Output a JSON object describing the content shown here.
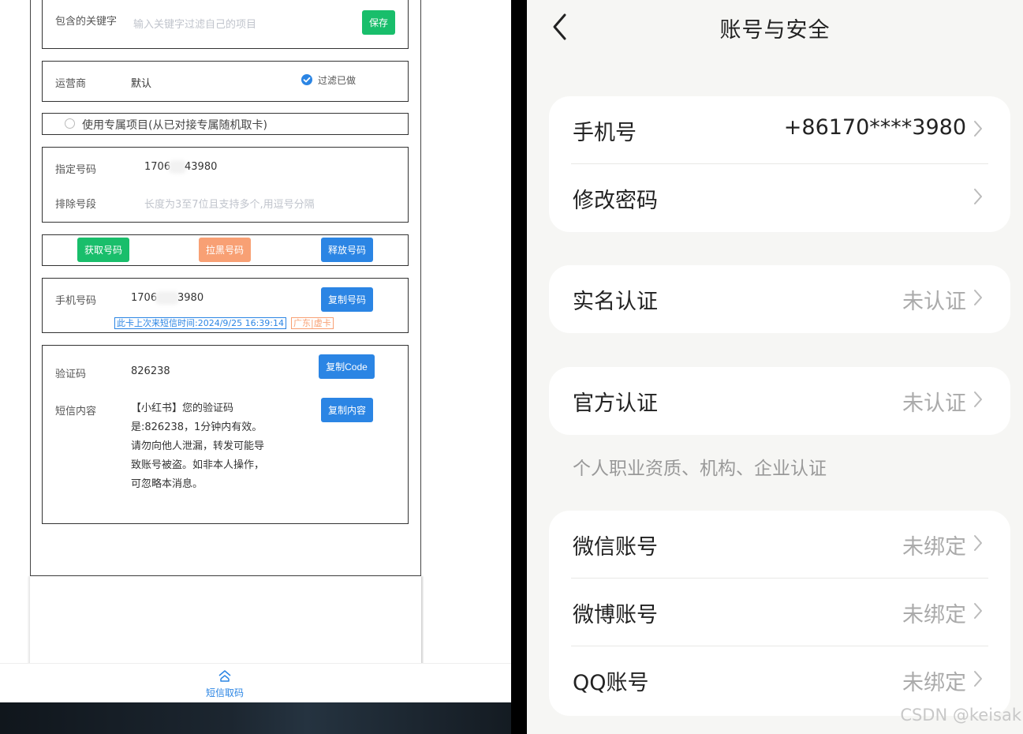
{
  "left": {
    "keyword": {
      "label": "包含的关键字",
      "placeholder": "输入关键字过滤自己的项目",
      "save_label": "保存"
    },
    "carrier": {
      "label": "运营商",
      "value": "默认",
      "filter_done_label": "过滤已做"
    },
    "exclusive": {
      "label": "使用专属项目(从已对接专属随机取卡)"
    },
    "number_filter": {
      "assigned_label": "指定号码",
      "assigned_value_start": "1706",
      "assigned_value_end": "43980",
      "exclude_label": "排除号段",
      "exclude_placeholder": "长度为3至7位且支持多个,用逗号分隔"
    },
    "actions": {
      "get_label": "获取号码",
      "blacklist_label": "拉黑号码",
      "release_label": "释放号码"
    },
    "phone": {
      "label": "手机号码",
      "value_start": "1706",
      "value_end": "3980",
      "copy_label": "复制号码",
      "last_sms_tag": "此卡上次来短信时间:2024/9/25 16:39:14",
      "region_tag": "广东|虚卡"
    },
    "code": {
      "label": "验证码",
      "value": "826238",
      "copy_label": "复制Code",
      "sms_label": "短信内容",
      "sms_text": "【小红书】您的验证码是:826238，1分钟内有效。请勿向他人泄漏，转发可能导致账号被盗。如非本人操作，可忽略本消息。",
      "copy_sms_label": "复制内容"
    },
    "tabbar": {
      "tab_label": "短信取码"
    }
  },
  "right": {
    "title": "账号与安全",
    "rows": [
      {
        "label": "手机号",
        "value": "+86170****3980"
      },
      {
        "label": "修改密码",
        "value": ""
      },
      {
        "label": "实名认证",
        "value": "未认证"
      },
      {
        "label": "官方认证",
        "value": "未认证"
      },
      {
        "label": "微信账号",
        "value": "未绑定"
      },
      {
        "label": "微博账号",
        "value": "未绑定"
      },
      {
        "label": "QQ账号",
        "value": "未绑定"
      }
    ],
    "official_note": "个人职业资质、机构、企业认证"
  },
  "watermark": "CSDN @keisak",
  "colors": {
    "green": "#19be6b",
    "orange": "#f8a074",
    "blue": "#2b85e4"
  }
}
